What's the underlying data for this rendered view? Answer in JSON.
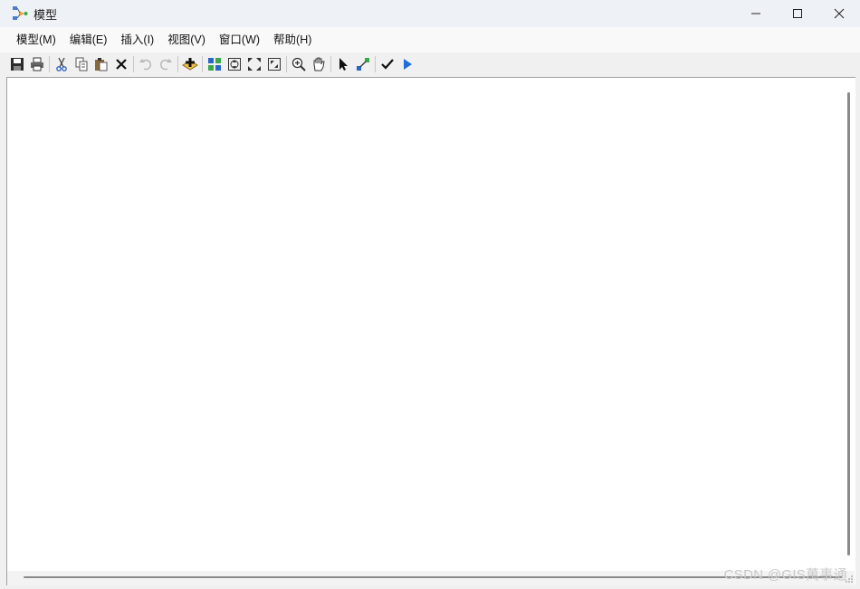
{
  "window": {
    "title": "模型"
  },
  "menu": {
    "items": [
      {
        "label": "模型(M)"
      },
      {
        "label": "编辑(E)"
      },
      {
        "label": "插入(I)"
      },
      {
        "label": "视图(V)"
      },
      {
        "label": "窗口(W)"
      },
      {
        "label": "帮助(H)"
      }
    ]
  },
  "toolbar": {
    "icons": [
      "save-icon",
      "print-icon",
      "cut-icon",
      "copy-icon",
      "paste-icon",
      "delete-icon",
      "undo-icon",
      "redo-icon",
      "add-data-icon",
      "auto-layout-icon",
      "full-extent-icon",
      "zoom-in-fixed-icon",
      "zoom-out-fixed-icon",
      "zoom-in-icon",
      "pan-icon",
      "select-icon",
      "connect-icon",
      "validate-icon",
      "run-icon"
    ]
  },
  "watermark": "CSDN @GIS萬事通",
  "colors": {
    "accent": "#1e6fd9",
    "titlebar": "#eef1f6"
  }
}
